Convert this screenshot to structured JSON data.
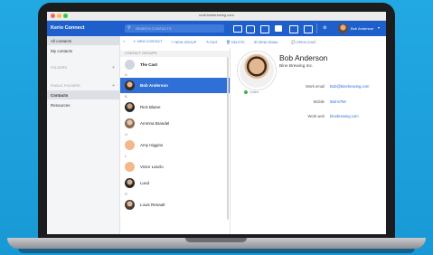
{
  "window": {
    "url": "mail.binebrewing.com"
  },
  "header": {
    "brand": "Kerio Connect",
    "search_placeholder": "SEARCH CONTACTS",
    "user_name": "Bob Anderson",
    "caret": "▾"
  },
  "sidebar": {
    "items": [
      {
        "label": "All contacts"
      },
      {
        "label": "My contacts"
      }
    ],
    "folders_label": "FOLDERS",
    "public_folders_label": "PUBLIC FOLDERS",
    "public_items": [
      {
        "label": "Contacts"
      },
      {
        "label": "Resources"
      }
    ],
    "plus": "+"
  },
  "toolbar": {
    "new_contact": "NEW CONTACT",
    "new_group": "NEW GROUP",
    "edit": "EDIT",
    "delete": "DELETE",
    "send_email": "SEND EMAIL",
    "open_chat": "OPEN CHAT"
  },
  "list": {
    "group_header": "CONTACT GROUPS",
    "group_name": "The Cast",
    "rows": [
      {
        "letter": "A",
        "name": "Bob Anderson"
      },
      {
        "letter": "B",
        "name": "Rick Blaine"
      },
      {
        "letter": "",
        "name": "Ammna Brandel"
      },
      {
        "letter": "H",
        "name": "Amy Higgins"
      },
      {
        "letter": "L",
        "name": "Victor Laszlo"
      },
      {
        "letter": "",
        "name": "Lund"
      },
      {
        "letter": "R",
        "name": "Louis Renault"
      }
    ]
  },
  "detail": {
    "name": "Bob Anderson",
    "company": "Bine Brewing Inc.",
    "status": "Online",
    "fields": [
      {
        "label": "Work email",
        "value": "Bob@binebrewing.com"
      },
      {
        "label": "Mobile",
        "value": "555-6759"
      },
      {
        "label": "Work web",
        "value": "binebrewing.com"
      }
    ]
  },
  "colors": {
    "accent": "#1f5fcb",
    "selected": "#2f6fd6",
    "online": "#3bb44a",
    "background": "#1aa0dc"
  }
}
